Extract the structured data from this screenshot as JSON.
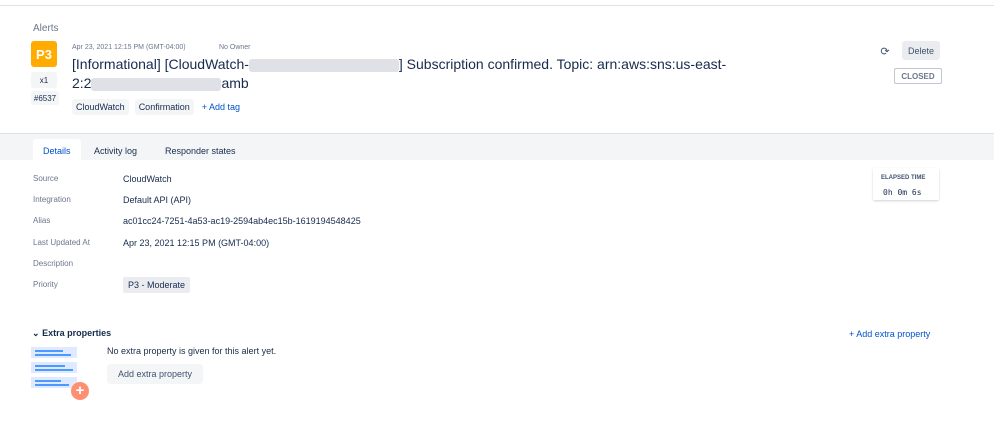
{
  "breadcrumb": "Alerts",
  "alert": {
    "priority": "P3",
    "count": "x1",
    "tiny_id": "#6537",
    "created_at": "Apr 23, 2021 12:15 PM (GMT-04:00)",
    "owner": "No Owner",
    "title_part1": "[Informational] [CloudWatch-",
    "title_part2": "] Subscription confirmed. Topic: arn:aws:sns:us-east-2:2",
    "title_part3": "amb",
    "tags": [
      "CloudWatch",
      "Confirmation"
    ],
    "add_tag_label": "+ Add tag",
    "status": "CLOSED"
  },
  "actions": {
    "refresh_icon": "refresh-icon",
    "delete_label": "Delete"
  },
  "tabs": [
    {
      "label": "Details",
      "active": true
    },
    {
      "label": "Activity log",
      "active": false
    },
    {
      "label": "Responder states",
      "active": false
    }
  ],
  "details": [
    {
      "label": "Source",
      "value": "CloudWatch"
    },
    {
      "label": "Integration",
      "value": "Default API (API)"
    },
    {
      "label": "Alias",
      "value": "ac01cc24-7251-4a53-ac19-2594ab4ec15b-1619194548425"
    },
    {
      "label": "Last Updated At",
      "value": "Apr 23, 2021 12:15 PM (GMT-04:00)"
    },
    {
      "label": "Description",
      "value": ""
    },
    {
      "label": "Priority",
      "value": "P3 - Moderate"
    }
  ],
  "elapsed": {
    "label": "ELAPSED TIME",
    "value": "0h 0m 6s"
  },
  "extra_properties": {
    "heading": "Extra properties",
    "add_link": "+ Add extra property",
    "empty_message": "No extra property is given for this alert yet.",
    "add_button": "Add extra property"
  },
  "colors": {
    "priority_bg": "#ffab00",
    "link": "#0052cc"
  }
}
